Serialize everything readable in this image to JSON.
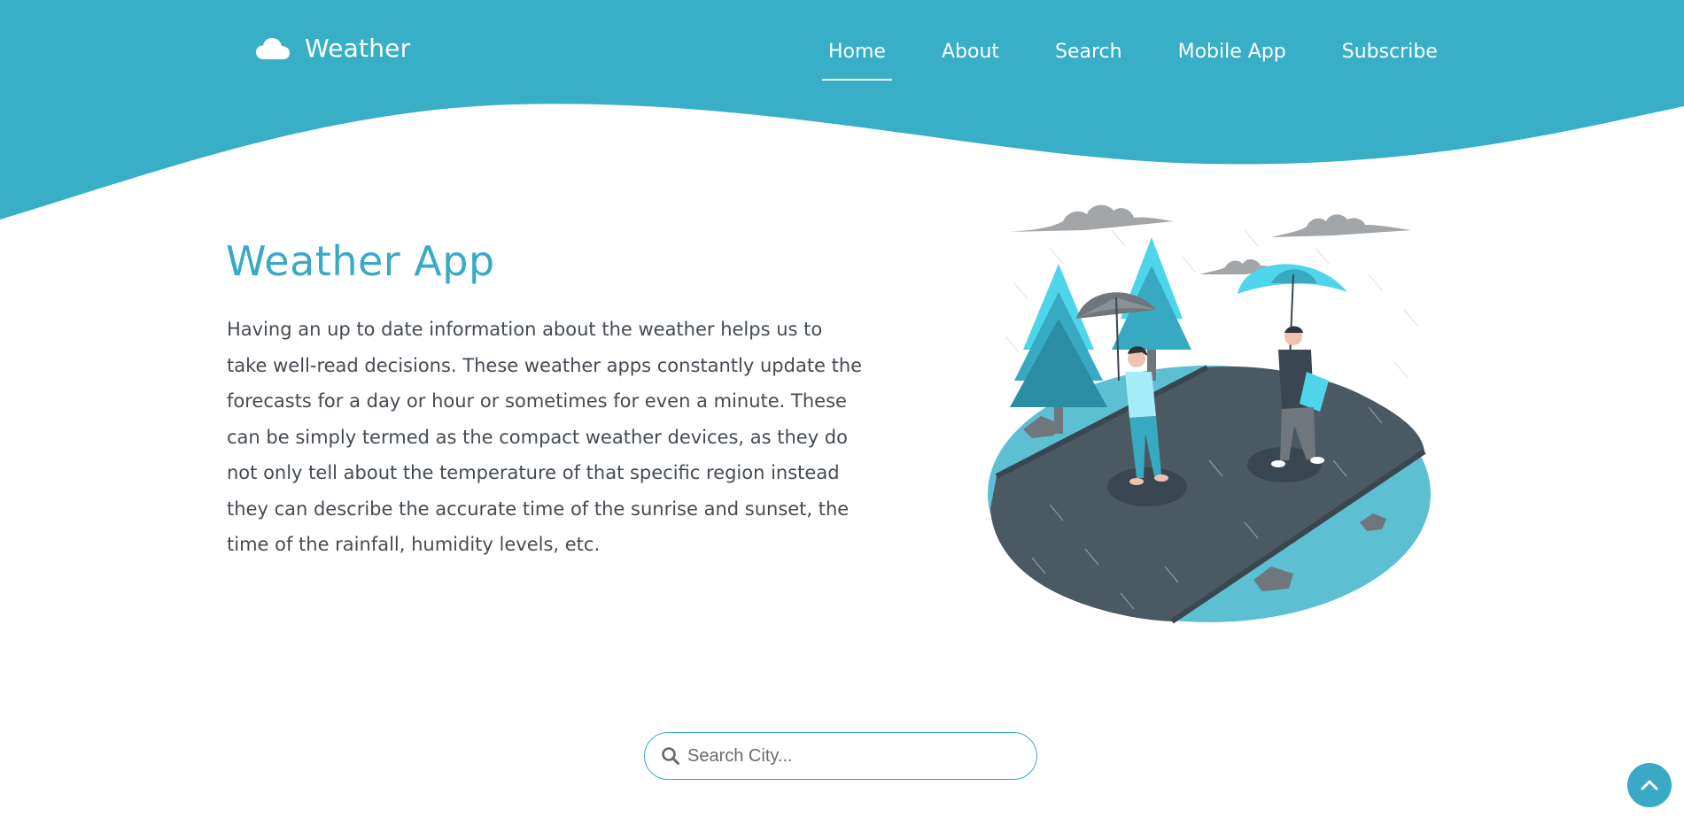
{
  "colors": {
    "brand": "#3aa9c4",
    "text": "#444b52",
    "white": "#ffffff",
    "road": "#4b5963",
    "cloud": "#a3a6a9"
  },
  "header": {
    "brand_icon": "cloud-icon",
    "brand_name": "Weather",
    "nav": [
      {
        "label": "Home",
        "active": true
      },
      {
        "label": "About",
        "active": false
      },
      {
        "label": "Search",
        "active": false
      },
      {
        "label": "Mobile App",
        "active": false
      },
      {
        "label": "Subscribe",
        "active": false
      }
    ]
  },
  "hero": {
    "title": "Weather App",
    "description": "Having an up to date information about the weather helps us to take well-read decisions. These weather apps constantly update the forecasts for a day or hour or sometimes for even a minute. These can be simply termed as the compact weather devices, as they do not only tell about the temperature of that specific region instead they can describe the accurate time of the sunrise and sunset, the time of the rainfall, humidity levels, etc."
  },
  "illustration": {
    "icon": "people-with-umbrellas-in-rain-illustration"
  },
  "search": {
    "icon": "search-icon",
    "placeholder": "Search City...",
    "value": ""
  },
  "scroll_top": {
    "icon": "chevron-up-icon"
  }
}
